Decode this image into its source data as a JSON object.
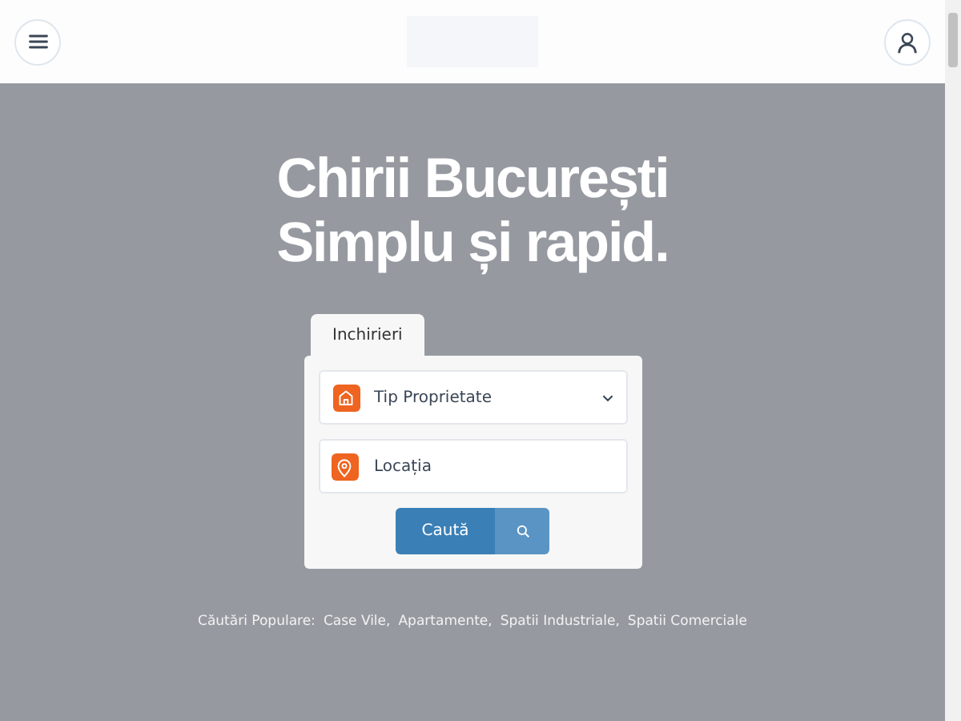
{
  "hero": {
    "title_lines": [
      "Chirii București",
      "Simplu și rapid."
    ]
  },
  "search": {
    "tabs": [
      {
        "label": "Inchirieri",
        "selected": true
      }
    ],
    "fields": [
      {
        "kind": "select",
        "placeholder": "Tip Proprietate"
      },
      {
        "kind": "text",
        "placeholder": "Locația"
      }
    ],
    "button": "Caută"
  },
  "popular": {
    "label": "Căutări Populare:",
    "links": [
      "Case Vile,",
      "Apartamente,",
      "Spatii Industriale,",
      "Spatii Comerciale"
    ]
  }
}
